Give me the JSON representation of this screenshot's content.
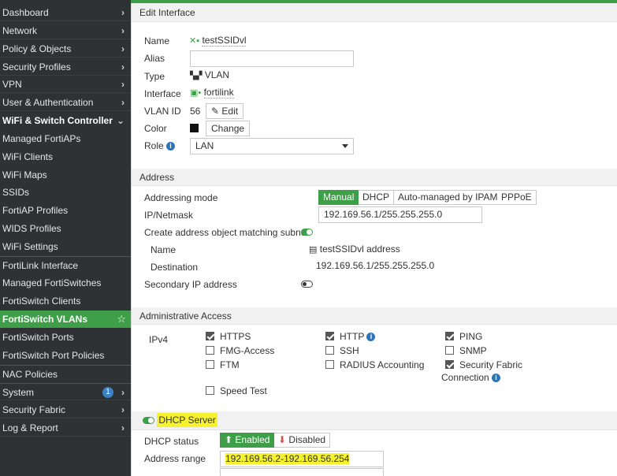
{
  "sidebar": {
    "items": [
      {
        "label": "Dashboard"
      },
      {
        "label": "Network"
      },
      {
        "label": "Policy & Objects"
      },
      {
        "label": "Security Profiles"
      },
      {
        "label": "VPN"
      },
      {
        "label": "User & Authentication"
      },
      {
        "label": "WiFi & Switch Controller"
      },
      {
        "label": "Managed FortiAPs"
      },
      {
        "label": "WiFi Clients"
      },
      {
        "label": "WiFi Maps"
      },
      {
        "label": "SSIDs"
      },
      {
        "label": "FortiAP Profiles"
      },
      {
        "label": "WIDS Profiles"
      },
      {
        "label": "WiFi Settings"
      },
      {
        "label": "FortiLink Interface"
      },
      {
        "label": "Managed FortiSwitches"
      },
      {
        "label": "FortiSwitch Clients"
      },
      {
        "label": "FortiSwitch VLANs"
      },
      {
        "label": "FortiSwitch Ports"
      },
      {
        "label": "FortiSwitch Port Policies"
      },
      {
        "label": "NAC Policies"
      },
      {
        "label": "System",
        "badge": "1"
      },
      {
        "label": "Security Fabric"
      },
      {
        "label": "Log & Report"
      }
    ]
  },
  "page": {
    "title": "Edit Interface"
  },
  "general": {
    "name_label": "Name",
    "name_value": "testSSIDvl",
    "alias_label": "Alias",
    "alias_value": "",
    "type_label": "Type",
    "type_value": "VLAN",
    "interface_label": "Interface",
    "interface_value": "fortilink",
    "vlanid_label": "VLAN ID",
    "vlanid_value": "56",
    "edit_label": "Edit",
    "color_label": "Color",
    "color_value": "#111111",
    "change_label": "Change",
    "role_label": "Role",
    "role_value": "LAN"
  },
  "address": {
    "section": "Address",
    "mode_label": "Addressing mode",
    "modes": [
      "Manual",
      "DHCP",
      "Auto-managed by IPAM",
      "PPPoE"
    ],
    "ipnetmask_label": "IP/Netmask",
    "ipnetmask_value": "192.169.56.1/255.255.255.0",
    "create_obj_label": "Create address object matching subnet",
    "obj_name_label": "Name",
    "obj_name_value": "testSSIDvl address",
    "obj_dest_label": "Destination",
    "obj_dest_value": "192.169.56.1/255.255.255.0",
    "secondary_label": "Secondary IP address"
  },
  "admin": {
    "section": "Administrative Access",
    "ipv4_label": "IPv4",
    "https": "HTTPS",
    "http": "HTTP",
    "ping": "PING",
    "fmg": "FMG-Access",
    "ssh": "SSH",
    "snmp": "SNMP",
    "ftm": "FTM",
    "radius": "RADIUS Accounting",
    "sf_line1": "Security Fabric",
    "sf_line2": "Connection",
    "speed": "Speed Test"
  },
  "dhcp": {
    "section": "DHCP Server",
    "status_label": "DHCP status",
    "enabled": "Enabled",
    "disabled": "Disabled",
    "range_label": "Address range",
    "range_value": "192.169.56.2-192.169.56.254"
  },
  "icons": {
    "info": "i",
    "star": "☆",
    "chevron": "›",
    "chevron_down": "⌄"
  }
}
